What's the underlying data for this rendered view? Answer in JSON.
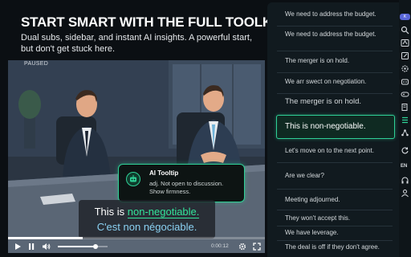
{
  "promo": {
    "title": "START SMART WITH THE FULL TOOLKIT.",
    "subtitle": "Dual subs, sidebar, and instant AI insights. A powerful start, but don't get stuck here."
  },
  "video": {
    "status_badge": "PAUSED",
    "progress": 0.29,
    "volume": 0.75,
    "time": "0:00:12"
  },
  "tooltip": {
    "title": "AI Tooltip",
    "body": "adj. Not open to discussion. Show firmness."
  },
  "subtitles": {
    "line1_prefix": "This is ",
    "line1_highlight": "non-negotiable.",
    "line2": "C'est non négociable."
  },
  "transcript": {
    "items": [
      "We need to address the budget.",
      "We need to address the budget.",
      "The merger is on hold.",
      "We arr swect on negotiation.",
      "The merger is on hold.",
      "This is non-negotiable.",
      "Let's move on to the next point.",
      "Are we clear?",
      "Meeting adjourned.",
      "They won't accept this.",
      "We have leverage.",
      "The deal is off if they don't agree."
    ],
    "active_index": 5
  },
  "rail": {
    "badge": "K",
    "language": "EN",
    "icons": [
      "search-icon",
      "translate-icon",
      "edit-icon",
      "settings-icon",
      "bot-icon",
      "gamepad-icon",
      "book-icon",
      "list-icon",
      "network-icon",
      "refresh-icon",
      "language-label",
      "headphones-icon",
      "user-icon"
    ]
  },
  "colors": {
    "accent": "#2fd197",
    "subtitle_secondary": "#8ad1f2",
    "panel_bg": "#111a1f"
  }
}
